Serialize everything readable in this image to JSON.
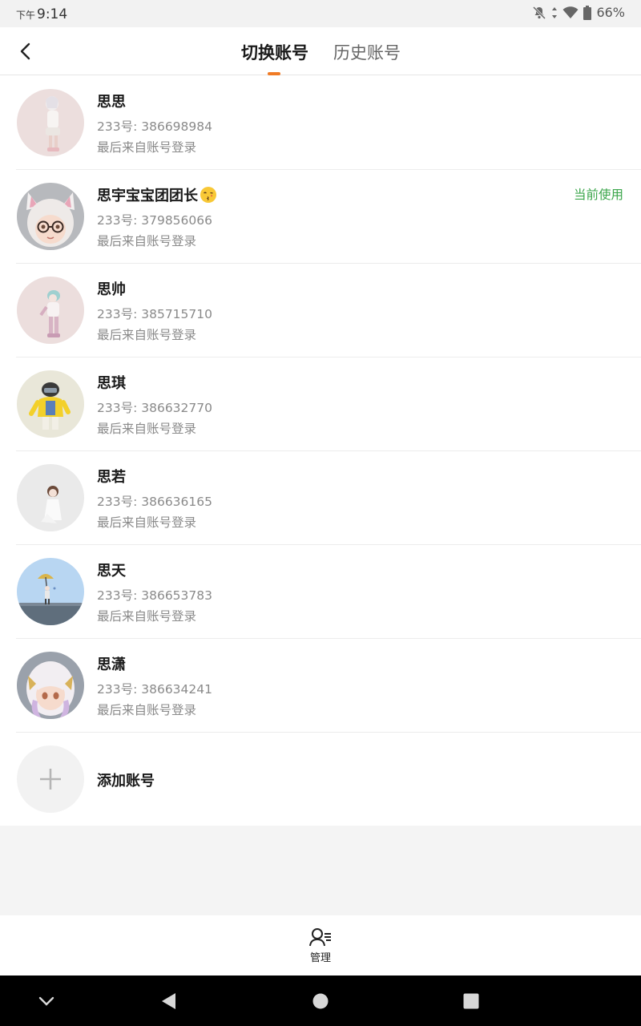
{
  "status": {
    "ampm": "下午",
    "time": "9:14",
    "battery": "66%"
  },
  "header": {
    "tabs": [
      {
        "label": "切换账号",
        "active": true
      },
      {
        "label": "历史账号",
        "active": false
      }
    ]
  },
  "accounts": [
    {
      "name": "思思",
      "id": "233号: 386698984",
      "login": "最后来自账号登录",
      "avatar_icon": "avatar-girl-white-outfit-icon"
    },
    {
      "name": "思宇宝宝团团长",
      "id": "233号: 379856066",
      "login": "最后来自账号登录",
      "badge": "当前使用",
      "avatar_icon": "avatar-cat-ear-glasses-icon"
    },
    {
      "name": "思帅",
      "id": "233号: 385715710",
      "login": "最后来自账号登录",
      "avatar_icon": "avatar-figure-pink-icon"
    },
    {
      "name": "思琪",
      "id": "233号: 386632770",
      "login": "最后来自账号登录",
      "avatar_icon": "avatar-yellow-jacket-icon"
    },
    {
      "name": "思若",
      "id": "233号: 386636165",
      "login": "最后来自账号登录",
      "avatar_icon": "avatar-girl-white-dress-icon"
    },
    {
      "name": "思天",
      "id": "233号: 386653783",
      "login": "最后来自账号登录",
      "avatar_icon": "avatar-umbrella-sky-icon"
    },
    {
      "name": "思潇",
      "id": "233号: 386634241",
      "login": "最后来自账号登录",
      "avatar_icon": "avatar-white-hair-girl-icon"
    }
  ],
  "add_account": {
    "label": "添加账号"
  },
  "bottom": {
    "manage_label": "管理"
  },
  "colors": {
    "accent": "#f07b25",
    "current": "#3aa54a",
    "secondary_text": "#8a8a8a"
  }
}
